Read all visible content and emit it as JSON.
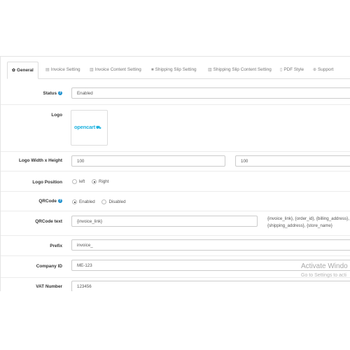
{
  "tabs": [
    {
      "label": "General",
      "icon": "gear-icon"
    },
    {
      "label": "Invoice Setting",
      "icon": "file-icon"
    },
    {
      "label": "Invoice Content Setting",
      "icon": "content-icon"
    },
    {
      "label": "Shipping Slip Setting",
      "icon": "truck-icon"
    },
    {
      "label": "Shipping Slip Content Setting",
      "icon": "content-icon"
    },
    {
      "label": "PDF Style",
      "icon": "pdf-icon"
    },
    {
      "label": "Support",
      "icon": "lifebuoy-icon"
    }
  ],
  "form": {
    "status": {
      "label": "Status",
      "value": "Enabled"
    },
    "logo": {
      "label": "Logo",
      "image_text": "opencart"
    },
    "logo_size": {
      "label": "Logo Width x Height",
      "width": "100",
      "height": "100"
    },
    "logo_position": {
      "label": "Logo Position",
      "options": [
        "left",
        "Right"
      ],
      "selected": "Right"
    },
    "qrcode": {
      "label": "QRCode",
      "options": [
        "Enabled",
        "Disabled"
      ],
      "selected": "Enabled"
    },
    "qrcode_text": {
      "label": "QRCode text",
      "value": "{invoice_link}",
      "hint_line1": "{invoice_link}, {order_id}, {billing_address},",
      "hint_line2": "{shipping_address}, {store_name}"
    },
    "prefix": {
      "label": "Prefix",
      "value": "invoice_"
    },
    "company_id": {
      "label": "Company ID",
      "value": "ME-123"
    },
    "vat_number": {
      "label": "VAT Number",
      "value": "123456"
    }
  },
  "watermark": {
    "line1": "Activate Windo",
    "line2": "Go to Settings to acti"
  },
  "colors": {
    "accent": "#1e91cf",
    "logo_blue": "#1fb3e0"
  }
}
